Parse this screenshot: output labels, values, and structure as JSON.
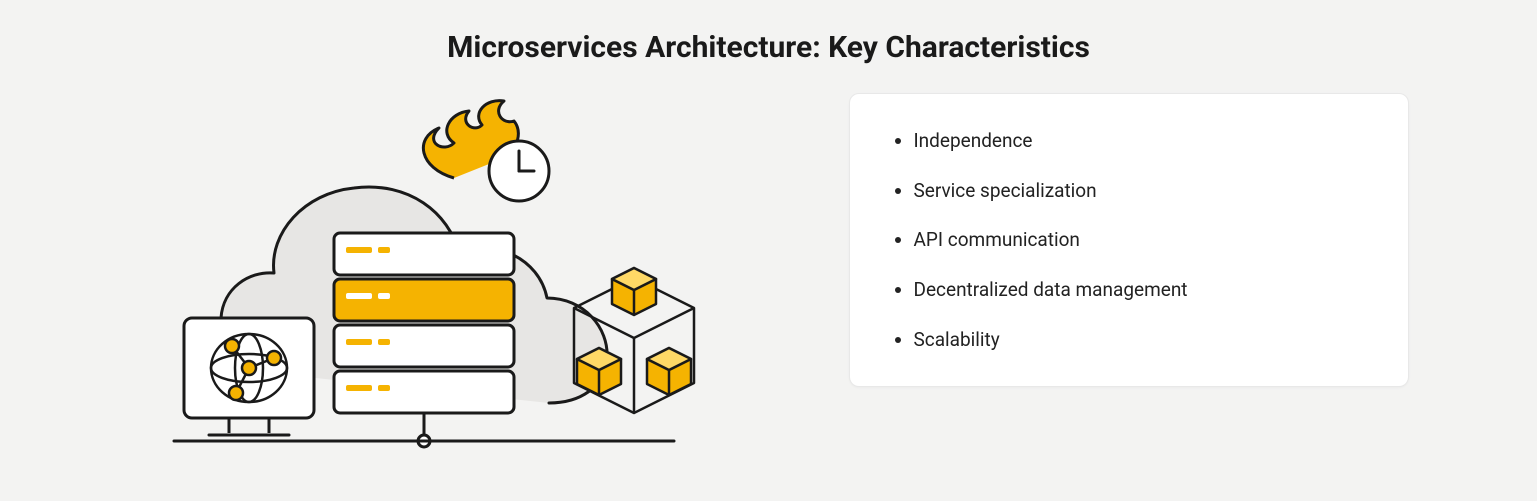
{
  "title": "Microservices Architecture: Key Characteristics",
  "characteristics": {
    "items": [
      {
        "label": "Independence"
      },
      {
        "label": "Service specialization"
      },
      {
        "label": "API communication"
      },
      {
        "label": "Decentralized data management"
      },
      {
        "label": "Scalability"
      }
    ]
  },
  "colors": {
    "background": "#f3f3f2",
    "card_bg": "#ffffff",
    "accent": "#f5b301",
    "outline": "#1a1a1a",
    "cloud_fill": "#e7e6e4"
  },
  "illustration": {
    "elements": [
      "cloud",
      "server-rack",
      "network-monitor",
      "container-cubes",
      "flame-clock"
    ]
  }
}
